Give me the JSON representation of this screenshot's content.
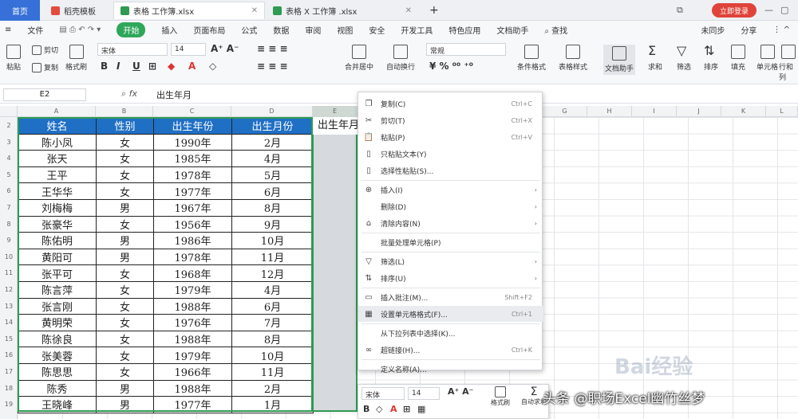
{
  "tabs": {
    "home": "首页",
    "doc1": "稻壳模板",
    "doc2": "表格 工作簿.xlsx",
    "doc3": "表格 X 工作簿 .xlsx",
    "plus": "+",
    "login": "立即登录"
  },
  "menu": [
    "文件",
    "开始",
    "插入",
    "页面布局",
    "公式",
    "数据",
    "审阅",
    "视图",
    "安全",
    "开发工具",
    "特色应用",
    "文档助手",
    "查找"
  ],
  "menu_right": [
    "未同步",
    "分享"
  ],
  "ribbon": {
    "paste": "粘贴",
    "cut": "剪切",
    "copy": "复制",
    "format_painter": "格式刷",
    "font": "宋体",
    "size": "14",
    "merge": "合并居中",
    "wrap": "自动换行",
    "number_format": "常规",
    "cond_format": "条件格式",
    "table_style": "表格样式",
    "sum": "求和",
    "filter": "筛选",
    "sort": "排序",
    "fill": "填充",
    "cell": "单元格",
    "rowcol": "行和列",
    "doc_assist": "文档助手"
  },
  "formula_bar": {
    "name_box": "E2",
    "fx": "fx",
    "value": "出生年月"
  },
  "columns": [
    "A",
    "B",
    "C",
    "D",
    "E",
    "F",
    "G",
    "H",
    "I",
    "J",
    "K",
    "L"
  ],
  "rows": [
    "2",
    "3",
    "4",
    "5",
    "6",
    "7",
    "8",
    "9",
    "10",
    "11",
    "12",
    "13",
    "14",
    "15",
    "16",
    "17",
    "18",
    "19"
  ],
  "table": {
    "headers": [
      "姓名",
      "性别",
      "出生年份",
      "出生月份"
    ],
    "rows": [
      [
        "陈小凤",
        "女",
        "1990年",
        "2月"
      ],
      [
        "张天",
        "女",
        "1985年",
        "4月"
      ],
      [
        "王平",
        "女",
        "1978年",
        "5月"
      ],
      [
        "王华华",
        "女",
        "1977年",
        "6月"
      ],
      [
        "刘梅梅",
        "男",
        "1967年",
        "8月"
      ],
      [
        "张豪华",
        "女",
        "1956年",
        "9月"
      ],
      [
        "陈佑明",
        "男",
        "1986年",
        "10月"
      ],
      [
        "黄阳可",
        "男",
        "1978年",
        "11月"
      ],
      [
        "张平可",
        "女",
        "1968年",
        "12月"
      ],
      [
        "陈言萍",
        "女",
        "1979年",
        "4月"
      ],
      [
        "张言刚",
        "女",
        "1988年",
        "6月"
      ],
      [
        "黄明荣",
        "女",
        "1976年",
        "7月"
      ],
      [
        "陈徐良",
        "女",
        "1988年",
        "8月"
      ],
      [
        "张美蓉",
        "女",
        "1979年",
        "10月"
      ],
      [
        "陈思思",
        "女",
        "1966年",
        "11月"
      ],
      [
        "陈秀",
        "男",
        "1988年",
        "2月"
      ],
      [
        "王晓峰",
        "男",
        "1977年",
        "1月"
      ]
    ]
  },
  "e2_value": "出生年月",
  "context_menu": [
    {
      "icon": "copy-icon",
      "glyph": "❐",
      "label": "复制(C)",
      "shortcut": "Ctrl+C"
    },
    {
      "icon": "cut-icon",
      "glyph": "✂",
      "label": "剪切(T)",
      "shortcut": "Ctrl+X"
    },
    {
      "icon": "paste-icon",
      "glyph": "📋",
      "label": "粘贴(P)",
      "shortcut": "Ctrl+V"
    },
    {
      "icon": "paste-text-icon",
      "glyph": "▯",
      "label": "只粘贴文本(Y)",
      "shortcut": ""
    },
    {
      "icon": "paste-special-icon",
      "glyph": "▯",
      "label": "选择性粘贴(S)...",
      "shortcut": ""
    },
    {
      "icon": "insert-icon",
      "glyph": "⊕",
      "label": "插入(I)",
      "shortcut": "",
      "arrow": true
    },
    {
      "icon": "delete-icon",
      "glyph": "",
      "label": "删除(D)",
      "shortcut": "",
      "arrow": true
    },
    {
      "icon": "clear-icon",
      "glyph": "⌂",
      "label": "清除内容(N)",
      "shortcut": "",
      "arrow": true
    },
    {
      "icon": "batch-icon",
      "glyph": "",
      "label": "批量处理单元格(P)",
      "shortcut": ""
    },
    {
      "icon": "filter-icon",
      "glyph": "▽",
      "label": "筛选(L)",
      "shortcut": "",
      "arrow": true
    },
    {
      "icon": "sort-icon",
      "glyph": "⇅",
      "label": "排序(U)",
      "shortcut": "",
      "arrow": true
    },
    {
      "icon": "comment-icon",
      "glyph": "▭",
      "label": "插入批注(M)...",
      "shortcut": "Shift+F2"
    },
    {
      "icon": "format-cells-icon",
      "glyph": "▦",
      "label": "设置单元格格式(F)...",
      "shortcut": "Ctrl+1"
    },
    {
      "icon": "dropdown-list-icon",
      "glyph": "",
      "label": "从下拉列表中选择(K)...",
      "shortcut": ""
    },
    {
      "icon": "hyperlink-icon",
      "glyph": "∞",
      "label": "超链接(H)...",
      "shortcut": "Ctrl+K"
    },
    {
      "icon": "name-icon",
      "glyph": "",
      "label": "定义名称(A)...",
      "shortcut": ""
    }
  ],
  "mini_toolbar": {
    "font": "宋体",
    "size": "14",
    "format": "格式刷",
    "sum": "自动求和"
  },
  "watermark": "头条 @职场Excel幽竹丝梦",
  "baidu_mark": "Bai经验"
}
